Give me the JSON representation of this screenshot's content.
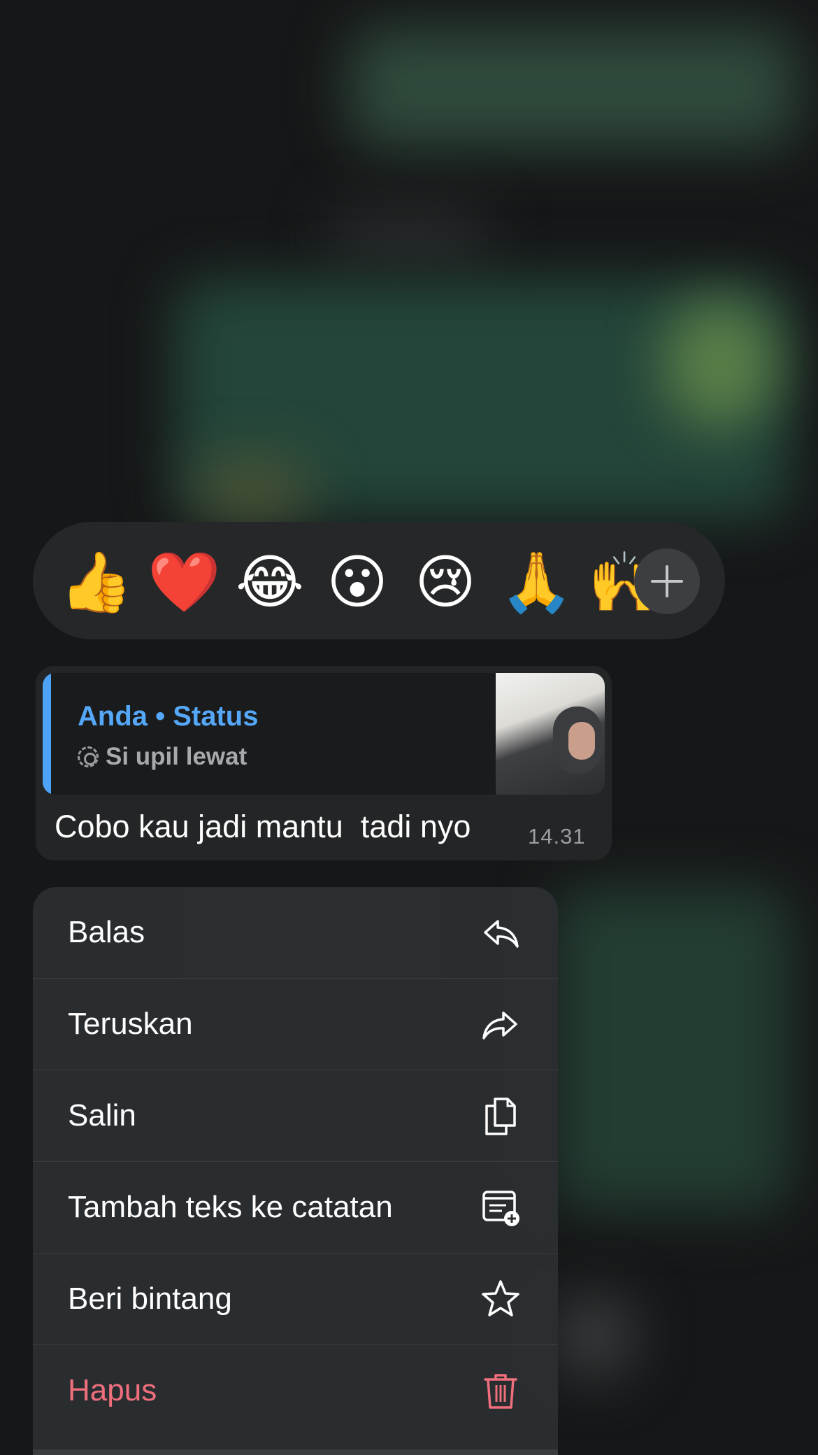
{
  "reactions": {
    "emojis": [
      "👍",
      "❤️",
      "😂",
      "😮",
      "😢",
      "🙏",
      "🙌"
    ],
    "add_icon": "plus-icon"
  },
  "message": {
    "quote_title": "Anda • Status",
    "quote_subtitle": "Si upil lewat",
    "text": "Cobo kau jadi mantu  tadi nyo",
    "time": "14.31"
  },
  "menu": {
    "items": [
      {
        "label": "Balas",
        "icon": "reply-icon"
      },
      {
        "label": "Teruskan",
        "icon": "forward-icon"
      },
      {
        "label": "Salin",
        "icon": "copy-icon"
      },
      {
        "label": "Tambah teks ke catatan",
        "icon": "add-note-icon"
      },
      {
        "label": "Beri bintang",
        "icon": "star-icon"
      },
      {
        "label": "Hapus",
        "icon": "trash-icon"
      }
    ]
  },
  "colors": {
    "accent_blue": "#55a7f8",
    "danger": "#ef6f7c"
  }
}
